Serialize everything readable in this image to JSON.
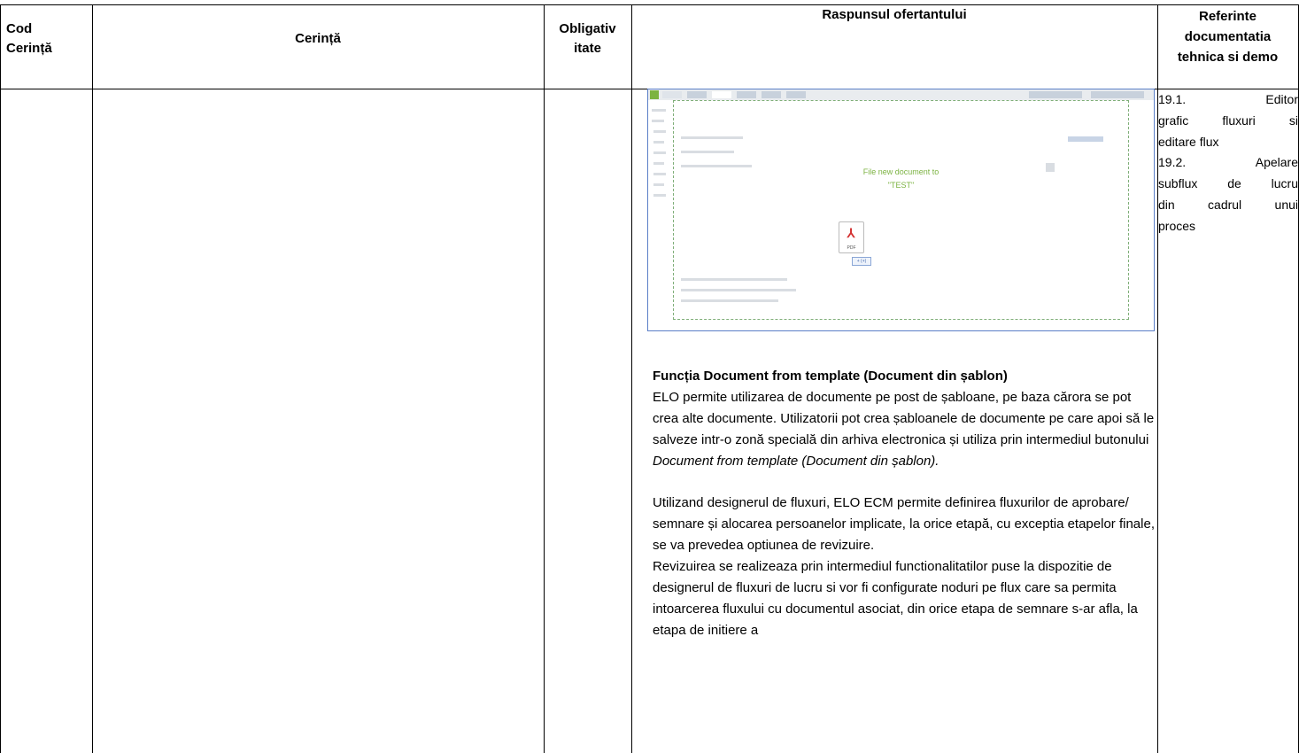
{
  "table": {
    "headers": {
      "code": "Cod Cerință",
      "requirement": "Cerință",
      "mandatory": "Obligativ itate",
      "response": "Raspunsul ofertantului",
      "references": "Referinte documentatia tehnica si demo"
    },
    "code_header_lines": [
      "Cod",
      "Cerință"
    ],
    "mandatory_header_lines": [
      "Obligativ",
      "itate"
    ],
    "references_header_lines": [
      "Referinte",
      "documentatia",
      "tehnica si demo"
    ]
  },
  "screenshot": {
    "app_name": "ELO",
    "drop_text_line1": "File new document to",
    "drop_text_line2": "\"TEST\"",
    "file_type": "PDF",
    "badge": "+ (+)",
    "icon": "pdf-file-icon"
  },
  "response": {
    "section_title": "Funcția Document from template (Document din șablon)",
    "para1_text": "ELO permite utilizarea de documente pe post de șabloane, pe baza cărora se pot crea alte documente. Utilizatorii pot crea șabloanele de documente pe care apoi să le salveze intr-o zonă specială din arhiva electronica și utiliza prin intermediul butonului ",
    "para1_italic": "Document from template (Document din șablon).",
    "para2": "Utilizand designerul de fluxuri, ELO ECM permite definirea fluxurilor de aprobare/ semnare și alocarea persoanelor implicate, la orice etapă, cu exceptia etapelor finale, se va prevedea optiunea de revizuire.",
    "para3": "Revizuirea se realizeaza prin intermediul functionalitatilor puse la dispozitie de designerul de fluxuri de lucru si vor fi configurate noduri pe flux care sa permita intoarcerea fluxului cu documentul asociat, din orice etapa de semnare s-ar afla, la etapa de initiere a"
  },
  "references": {
    "lines": [
      "19.1.          Editor",
      "grafic fluxuri si",
      "editare flux",
      "19.2.         Apelare",
      "subflux de lucru",
      "din cadrul unui",
      "proces"
    ]
  }
}
